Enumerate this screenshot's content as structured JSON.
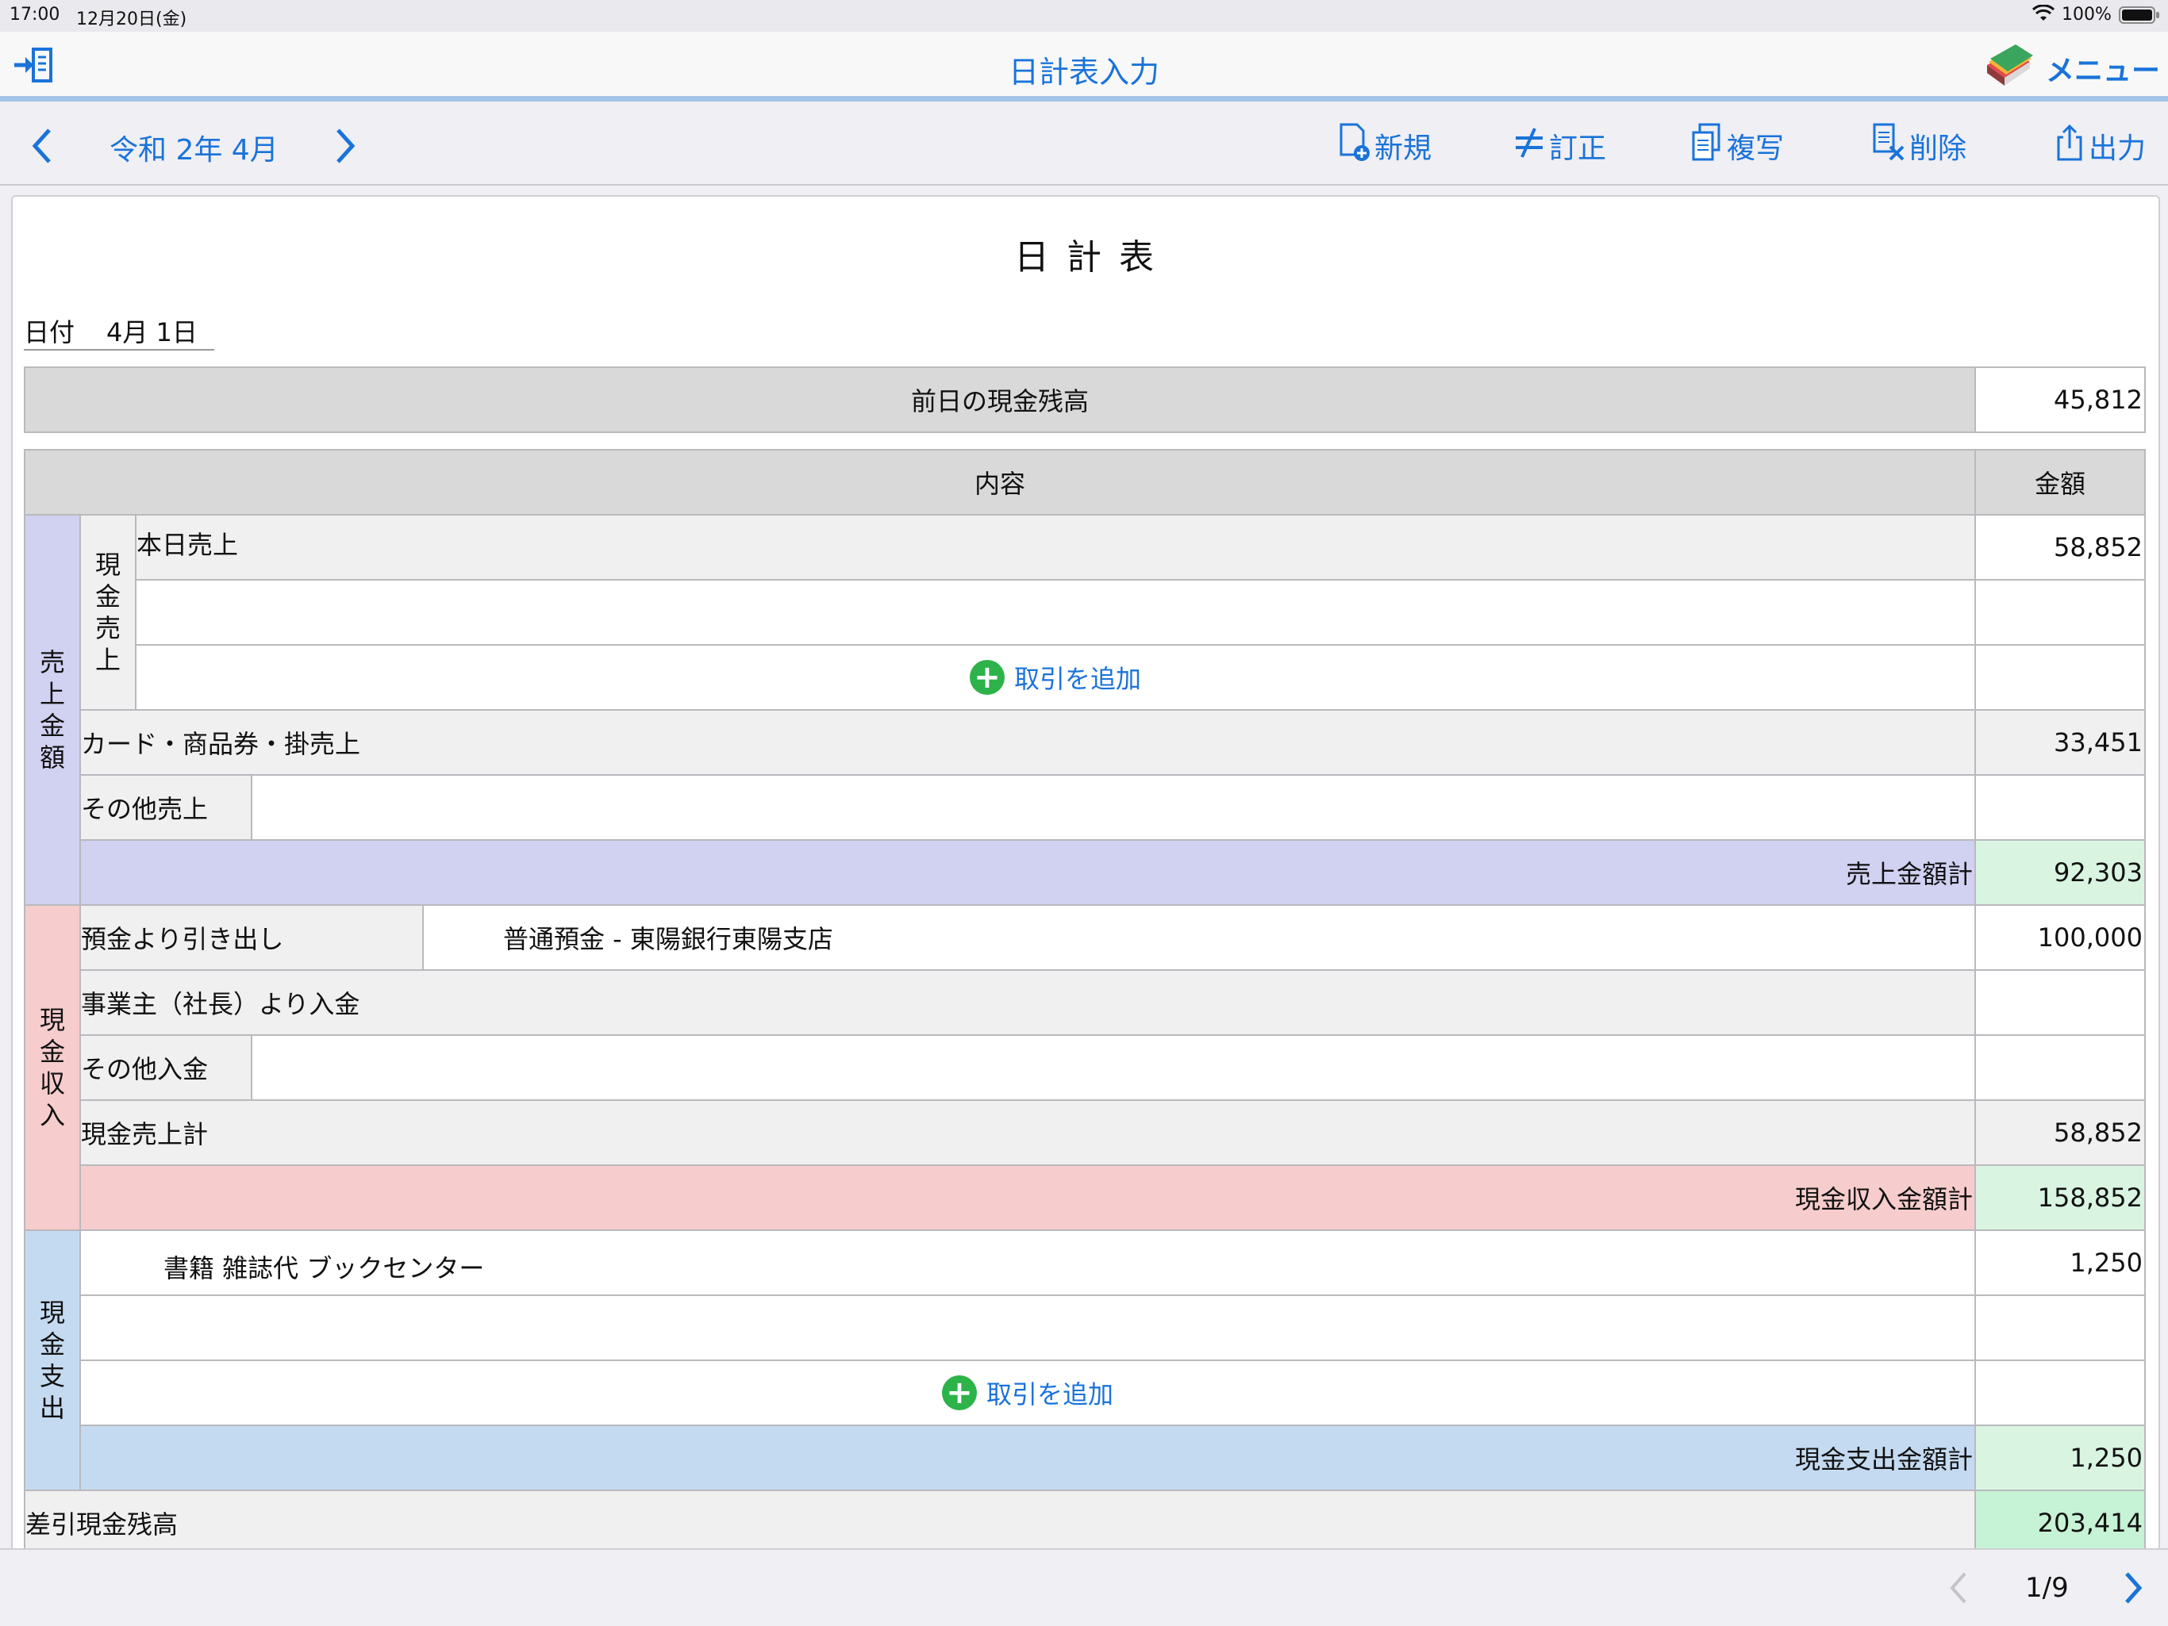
{
  "status": {
    "time": "17:00",
    "date": "12月20日(金)",
    "battery": "100%"
  },
  "nav": {
    "title": "日計表入力",
    "menu_label": "メニュー"
  },
  "toolbar": {
    "period": "令和 2年 4月",
    "new_label": "新規",
    "correct_label": "訂正",
    "copy_label": "複写",
    "delete_label": "削除",
    "output_label": "出力"
  },
  "sheet": {
    "title": "日 計 表",
    "date_label": "日付",
    "date_value": "4月 1日",
    "prev_balance_label": "前日の現金残高",
    "prev_balance_value": "45,812",
    "header_content": "内容",
    "header_amount": "金額",
    "sales": {
      "group_label": [
        "売",
        "上",
        "金",
        "額"
      ],
      "cash_sales_label": [
        "現",
        "金",
        "売",
        "上"
      ],
      "today_sales_label": "本日売上",
      "today_sales_value": "58,852",
      "add_transaction": "取引を追加",
      "card_label": "カード・商品券・掛売上",
      "card_value": "33,451",
      "other_label": "その他売上",
      "total_label": "売上金額計",
      "total_value": "92,303"
    },
    "income": {
      "group_label": [
        "現",
        "金",
        "収",
        "入"
      ],
      "withdraw_label": "預金より引き出し",
      "withdraw_account": "普通預金 - 東陽銀行東陽支店",
      "withdraw_value": "100,000",
      "owner_label": "事業主（社長）より入金",
      "other_label": "その他入金",
      "cash_sales_total_label": "現金売上計",
      "cash_sales_total_value": "58,852",
      "total_label": "現金収入金額計",
      "total_value": "158,852"
    },
    "expense": {
      "group_label": [
        "現",
        "金",
        "支",
        "出"
      ],
      "item1_label": "書籍 雑誌代 ブックセンター",
      "item1_value": "1,250",
      "add_transaction": "取引を追加",
      "total_label": "現金支出金額計",
      "total_value": "1,250"
    },
    "balance_label": "差引現金残高",
    "balance_value": "203,414"
  },
  "pager": {
    "text": "1/9"
  }
}
